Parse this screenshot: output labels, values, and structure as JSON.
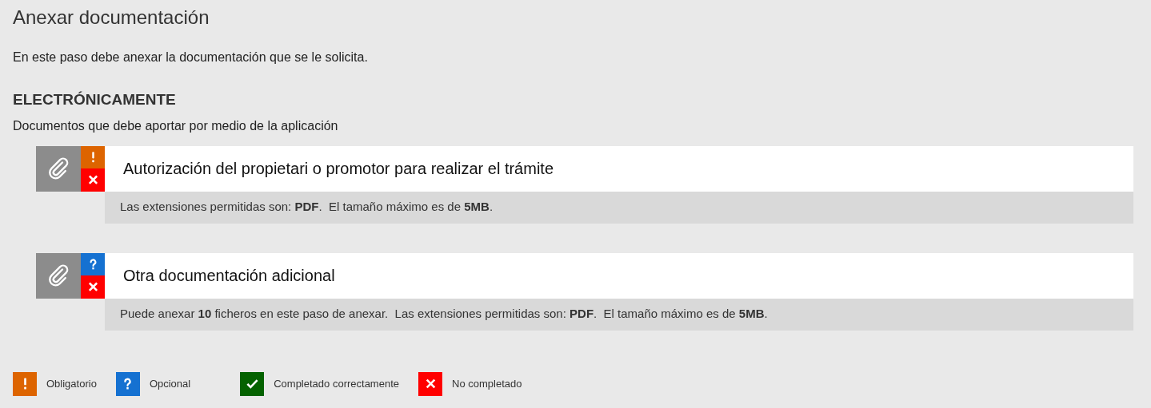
{
  "title": "Anexar documentación",
  "intro": "En este paso debe anexar la documentación que se le solicita.",
  "section": {
    "heading": "ELECTRÓNICAMENTE",
    "subtitle": "Documentos que debe aportar por medio de la aplicación",
    "documents": [
      {
        "name": "Autorización del propietari o promotor para realizar el trámite",
        "kind": "mandatory",
        "completed": false,
        "info": "Las extensiones permitidas son: **PDF**.  El tamaño máximo es de **5MB**."
      },
      {
        "name": "Otra documentación adicional",
        "kind": "optional",
        "completed": false,
        "info": "Puede anexar **10** ficheros en este paso de anexar.  Las extensiones permitidas son: **PDF**.  El tamaño máximo es de **5MB**."
      }
    ]
  },
  "legend": [
    {
      "kind": "mandatory",
      "label": "Obligatorio"
    },
    {
      "kind": "optional",
      "label": "Opcional"
    },
    {
      "kind": "completed",
      "label": "Completado correctamente"
    },
    {
      "kind": "not_completed",
      "label": "No completado"
    }
  ]
}
